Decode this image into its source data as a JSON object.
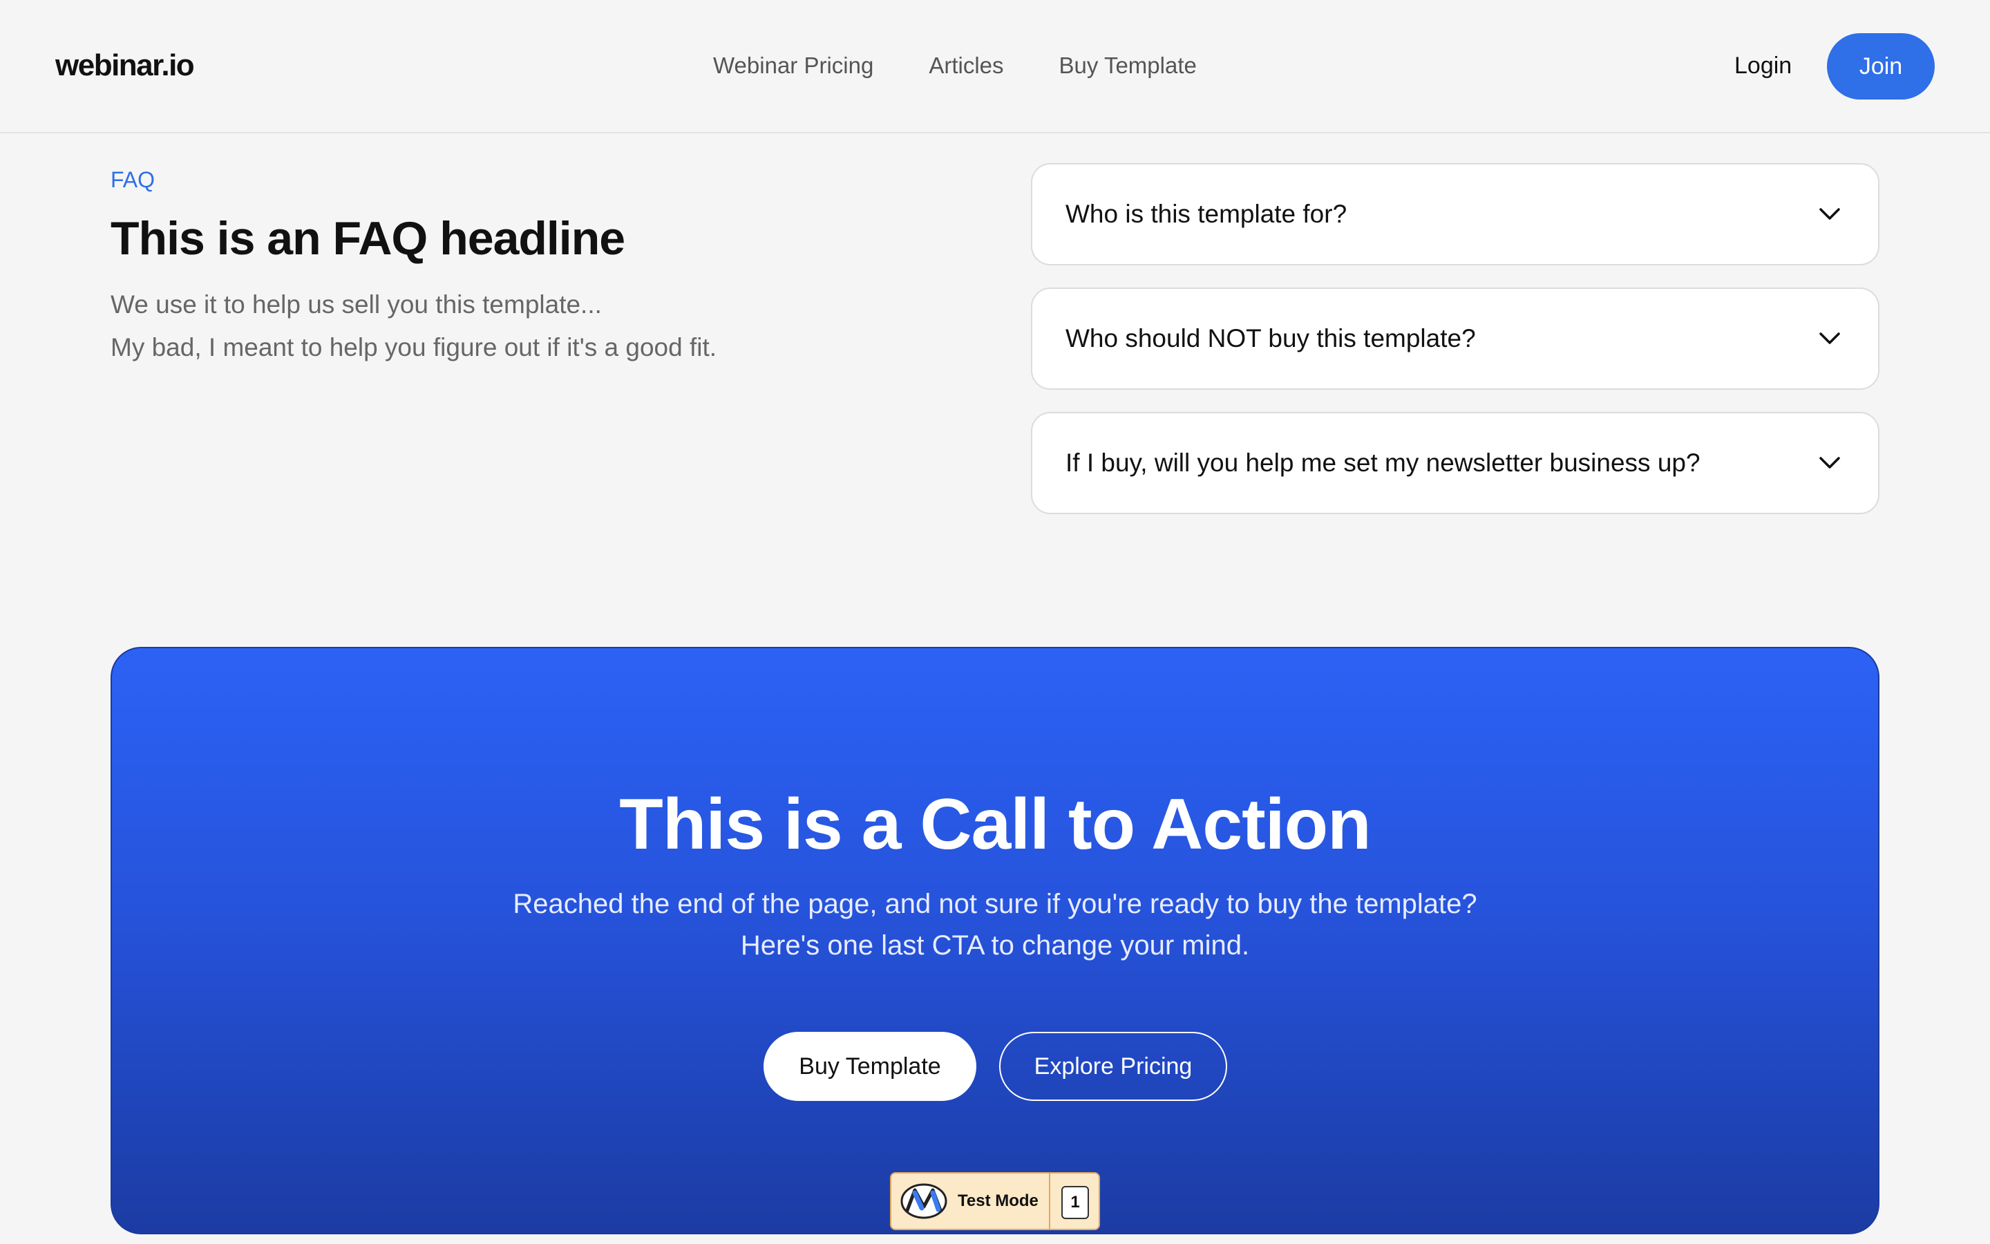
{
  "header": {
    "logo": "webinar.io",
    "nav": [
      "Webinar Pricing",
      "Articles",
      "Buy Template"
    ],
    "login": "Login",
    "join": "Join"
  },
  "faq": {
    "label": "FAQ",
    "headline": "This is an FAQ headline",
    "sub_line1": "We use it to help us sell you this template...",
    "sub_line2": "My bad, I meant to help you figure out if it's a good fit.",
    "questions": [
      "Who is this template for?",
      "Who should NOT buy this template?",
      "If I buy, will you help me set my newsletter business up?"
    ]
  },
  "cta": {
    "title": "This is a Call to Action",
    "sub_line1": "Reached the end of the page, and not sure if you're ready to buy the template?",
    "sub_line2": "Here's one last CTA to change your mind.",
    "buy": "Buy Template",
    "explore": "Explore Pricing"
  },
  "badge": {
    "label": "Test Mode",
    "count": "1",
    "icon": "m-logo-icon"
  },
  "colors": {
    "accent": "#2f6fe8",
    "cta_top": "#2c62f5",
    "cta_bottom": "#1c3ca3",
    "badge_bg": "#fbe9c8"
  }
}
